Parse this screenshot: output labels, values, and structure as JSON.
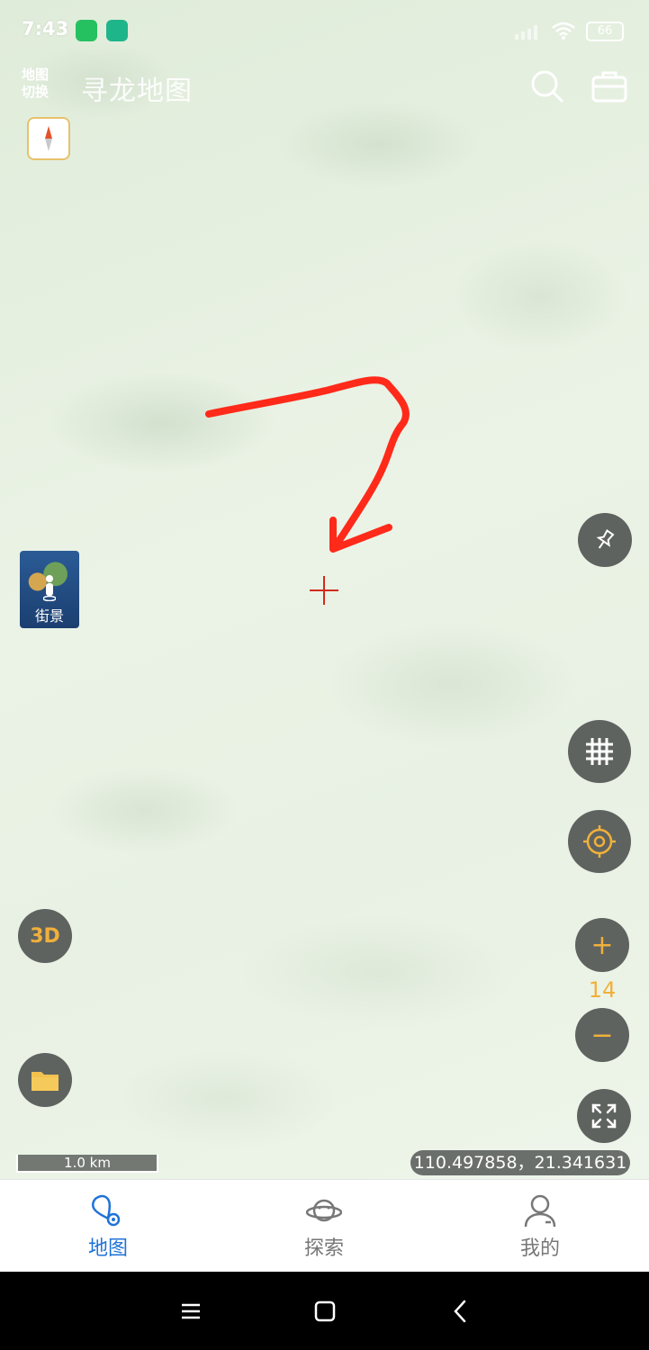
{
  "status_bar": {
    "time": "7:43",
    "battery": "66",
    "icons": [
      "wechat-icon",
      "shield-icon",
      "signal-icon",
      "wifi-icon",
      "battery-icon"
    ]
  },
  "header": {
    "map_switch_label": "地图\n切换",
    "title": "寻龙地图",
    "icons": [
      "search-icon",
      "toolbox-icon"
    ]
  },
  "streetview": {
    "label": "街景"
  },
  "map_controls": {
    "three_d_label": "3D",
    "zoom_in_label": "+",
    "zoom_out_label": "−",
    "zoom_level": "14",
    "icons": [
      "compass-icon",
      "pin-icon",
      "grid-icon",
      "locate-icon",
      "folder-icon",
      "fullscreen-icon"
    ]
  },
  "scale": {
    "label": "1.0 km"
  },
  "coordinates": {
    "text": "110.497858，21.341631"
  },
  "bottom_nav": {
    "items": [
      {
        "label": "地图",
        "icon": "map-location-icon",
        "active": true
      },
      {
        "label": "探索",
        "icon": "planet-icon",
        "active": false
      },
      {
        "label": "我的",
        "icon": "user-icon",
        "active": false
      }
    ]
  },
  "colors": {
    "accent": "#1f73d8",
    "control_bg": "#5f6360",
    "control_fg": "#f0b03b",
    "annotation": "#ff2a1a",
    "map_bg": "#e3efdf"
  }
}
